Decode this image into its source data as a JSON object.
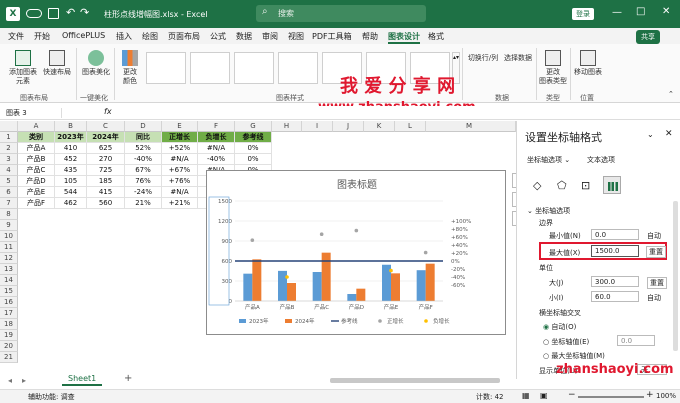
{
  "titlebar": {
    "filename": "柱形点线增幅图.xlsx - Excel",
    "search_placeholder": "搜索",
    "login": "登录",
    "autosave_icon": "save-icon"
  },
  "menu": [
    "文件",
    "开始",
    "OfficePLUS",
    "插入",
    "绘图",
    "页面布局",
    "公式",
    "数据",
    "审阅",
    "视图",
    "PDF工具箱",
    "帮助",
    "图表设计",
    "格式"
  ],
  "share_label": "共享",
  "ribbon": {
    "add_element": "添加图表\n元素",
    "quick_layout": "快速布局",
    "beautify": "图表美化",
    "change_colors": "更改\n颜色",
    "switch_row_col": "切换行/列",
    "select_data": "选择数据",
    "change_type": "更改\n图表类型",
    "move_chart": "移动图表",
    "groups": [
      "图表布局",
      "一键美化",
      "图表样式",
      "数据",
      "类型",
      "位置"
    ]
  },
  "watermark": {
    "cn": "我 爱 分 享 网",
    "url": "www.zhanshaoyi.com",
    "url2": "zhanshaoyi.com"
  },
  "formula": {
    "namebox": "图表 3",
    "fx": "fx"
  },
  "columns": [
    "A",
    "B",
    "C",
    "D",
    "E",
    "F",
    "G",
    "H",
    "I",
    "J",
    "K",
    "L",
    "M"
  ],
  "rows": [
    "1",
    "2",
    "3",
    "4",
    "5",
    "6",
    "7",
    "8",
    "9",
    "10",
    "11",
    "12",
    "13",
    "14",
    "15",
    "16",
    "17",
    "18",
    "19",
    "20",
    "21",
    "22"
  ],
  "table": {
    "headers": [
      "类别",
      "2023年",
      "2024年",
      "同比",
      "正增长",
      "负增长",
      "参考线"
    ],
    "data": [
      [
        "产品A",
        "410",
        "625",
        "52%",
        "+52%",
        "#N/A",
        "0%"
      ],
      [
        "产品B",
        "452",
        "270",
        "-40%",
        "#N/A",
        "-40%",
        "0%"
      ],
      [
        "产品C",
        "435",
        "725",
        "67%",
        "+67%",
        "#N/A",
        "0%"
      ],
      [
        "产品D",
        "105",
        "185",
        "76%",
        "+76%",
        "#N/A",
        "0%"
      ],
      [
        "产品E",
        "544",
        "415",
        "-24%",
        "#N/A",
        "-24%",
        "0%"
      ],
      [
        "产品F",
        "462",
        "560",
        "21%",
        "+21%",
        "#N/A",
        "0%"
      ]
    ]
  },
  "chart_data": {
    "type": "bar",
    "title": "图表标题",
    "categories": [
      "产品A",
      "产品B",
      "产品C",
      "产品D",
      "产品E",
      "产品F"
    ],
    "series": [
      {
        "name": "2023年",
        "values": [
          410,
          452,
          435,
          105,
          544,
          462
        ],
        "color": "#5b9bd5"
      },
      {
        "name": "2024年",
        "values": [
          625,
          270,
          725,
          185,
          415,
          560
        ],
        "color": "#ed7d31"
      },
      {
        "name": "参考线",
        "values": [
          600,
          600,
          600,
          600,
          600,
          600
        ],
        "color": "#264478"
      },
      {
        "name": "正增长",
        "values": [
          52,
          null,
          67,
          76,
          null,
          21
        ],
        "color": "#a5a5a5"
      },
      {
        "name": "负增长",
        "values": [
          null,
          -40,
          null,
          null,
          -24,
          null
        ],
        "color": "#ffc000"
      }
    ],
    "ylim": [
      0,
      1500
    ],
    "y_ticks": [
      "1500",
      "1200",
      "900",
      "600",
      "300",
      "0"
    ],
    "y2_ticks": [
      "+100%",
      "+80%",
      "+60%",
      "+40%",
      "+20%",
      "0%",
      "-20%",
      "-40%",
      "-60%"
    ]
  },
  "panel": {
    "title": "设置坐标轴格式",
    "tab1": "坐标轴选项",
    "tab2": "文本选项",
    "section": "坐标轴选项",
    "bounds": "边界",
    "min_label": "最小值(N)",
    "min_val": "0.0",
    "min_btn": "自动",
    "max_label": "最大值(X)",
    "max_val": "1500.0",
    "max_btn": "重置",
    "units": "单位",
    "major_label": "大(J)",
    "major_val": "300.0",
    "major_btn": "重置",
    "minor_label": "小(I)",
    "minor_val": "60.0",
    "minor_btn": "自动",
    "cross": "横坐标轴交叉",
    "auto": "自动(O)",
    "axis_val": "坐标轴值(E)",
    "axis_val_input": "0.0",
    "max_axis": "最大坐标轴值(M)",
    "display_units": "显示单位(U)",
    "display_units_val": "无"
  },
  "sheet": {
    "tab": "Sheet1",
    "add": "+"
  },
  "status": {
    "ready": "辅助功能: 调查",
    "count": "计数: 42",
    "zoom": "100%"
  }
}
